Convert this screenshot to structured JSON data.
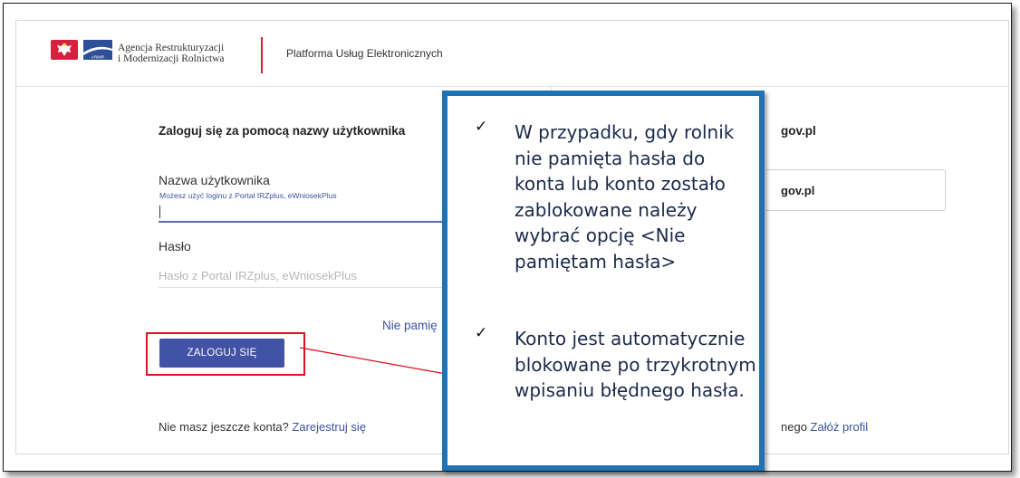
{
  "header": {
    "agency_line1": "Agencja Restrukturyzacji",
    "agency_line2": "i Modernizacji Rolnictwa",
    "logo_text": "ARiMR",
    "platform_title": "Platforma Usług Elektronicznych"
  },
  "login": {
    "heading": "Zaloguj się za pomocą nazwy użytkownika",
    "username_label": "Nazwa użytkownika",
    "username_hint": "Możesz użyć loginu z Portal IRZplus, eWniosekPlus",
    "username_value": "",
    "password_label": "Hasło",
    "password_placeholder": "Hasło z Portal IRZplus, eWniosekPlus",
    "forgot_link": "Nie pamię",
    "login_button": "ZALOGUJ SIĘ",
    "no_account_text": "Nie masz jeszcze konta?",
    "register_link": "Zarejestruj się"
  },
  "right_column": {
    "heading_fragment": "gov.pl",
    "button_fragment": "gov.pl",
    "bottom_text_fragment": "nego",
    "profile_link": "Załóż profil"
  },
  "callout": {
    "item1": "W przypadku, gdy rolnik nie pamięta hasła do konta lub konto zostało zablokowane należy wybrać opcję <Nie pamiętam hasła>",
    "item2": "Konto jest automatycznie blokowane po trzykrotnym wpisaniu błędnego hasła.",
    "check_glyph": "✓",
    "border_color": "#1f72b4"
  },
  "colors": {
    "button_bg": "#4252a4",
    "link": "#3b54a0",
    "highlight_red": "#e0101f",
    "divider_red": "#c82230"
  }
}
